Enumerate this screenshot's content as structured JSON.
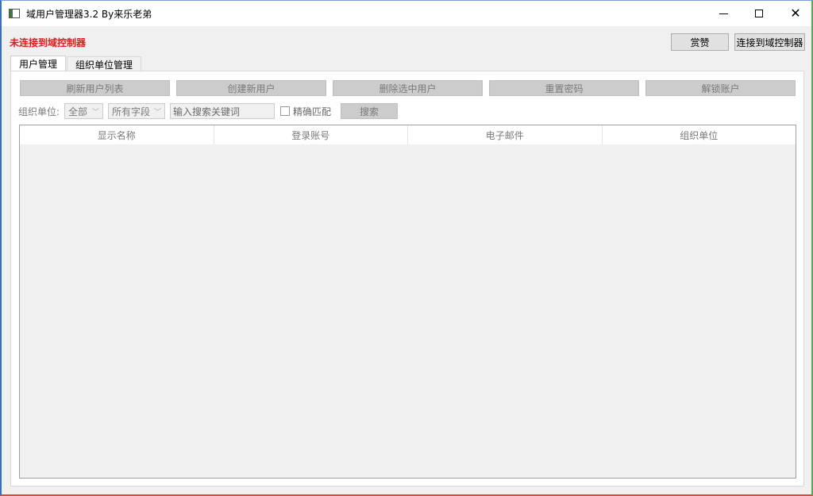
{
  "window": {
    "title": "域用户管理器3.2 By来乐老弟",
    "minimize_icon": "minimize-icon",
    "maximize_icon": "maximize-icon",
    "close_icon": "close-icon",
    "close_glyph": "✕"
  },
  "header": {
    "status_text": "未连接到域控制器",
    "status_color": "#e01c1c",
    "donate_label": "赏赞",
    "connect_label": "连接到域控制器"
  },
  "tabs": [
    {
      "label": "用户管理",
      "active": true
    },
    {
      "label": "组织单位管理",
      "active": false
    }
  ],
  "actions": [
    {
      "label": "刷新用户列表"
    },
    {
      "label": "创建新用户"
    },
    {
      "label": "删除选中用户"
    },
    {
      "label": "重置密码"
    },
    {
      "label": "解锁账户"
    }
  ],
  "filter": {
    "ou_label": "组织单位:",
    "ou_value": "全部",
    "field_value": "所有字段",
    "search_placeholder": "输入搜索关键词",
    "exact_match_label": "精确匹配",
    "exact_match_checked": false,
    "search_button": "搜索",
    "chevron_glyph": "﹀"
  },
  "table": {
    "columns": [
      "显示名称",
      "登录账号",
      "电子邮件",
      "组织单位"
    ],
    "rows": []
  }
}
